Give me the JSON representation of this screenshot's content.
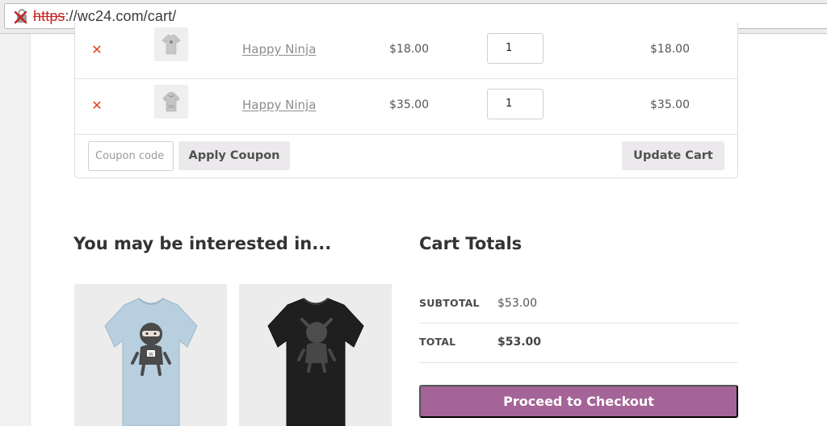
{
  "browser": {
    "url_scheme": "https",
    "url_rest": "://wc24.com/cart/",
    "icons": {
      "security": "broken-lock-icon"
    }
  },
  "cart": {
    "items": [
      {
        "name": "Happy Ninja",
        "price": "$18.00",
        "quantity": "1",
        "subtotal": "$18.00",
        "thumbnail": "tshirt-icon"
      },
      {
        "name": "Happy Ninja",
        "price": "$35.00",
        "quantity": "1",
        "subtotal": "$35.00",
        "thumbnail": "hoodie-icon"
      }
    ],
    "coupon_placeholder": "Coupon code",
    "apply_coupon_label": "Apply Coupon",
    "update_cart_label": "Update Cart",
    "remove_icon": "remove-x-icon"
  },
  "cross_sells": {
    "heading": "You may be interested in...",
    "products": [
      {
        "image": "light-blue-ninja-tshirt"
      },
      {
        "image": "black-ninja-tshirt"
      }
    ]
  },
  "totals": {
    "heading": "Cart Totals",
    "subtotal_label": "SUBTOTAL",
    "subtotal_value": "$53.00",
    "total_label": "TOTAL",
    "total_value": "$53.00",
    "checkout_label": "Proceed to Checkout"
  },
  "colors": {
    "accent": "#a46497",
    "remove": "#e2401c",
    "insecure_scheme": "#c5221f"
  }
}
